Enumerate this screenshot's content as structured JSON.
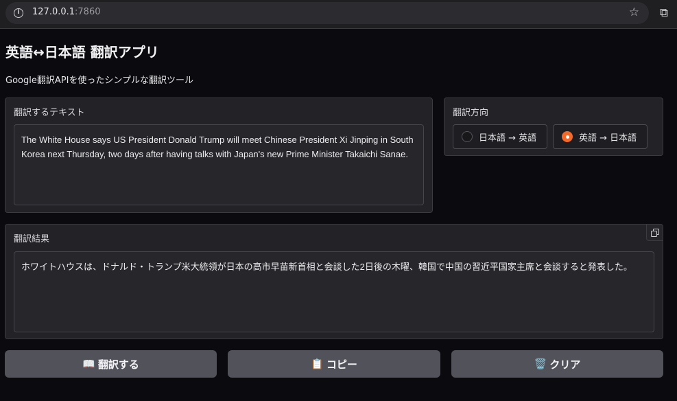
{
  "browser": {
    "url_host": "127.0.0.1",
    "url_port": ":7860",
    "icons": [
      "info-icon",
      "star-icon",
      "extensions-icon"
    ]
  },
  "app": {
    "title": "英語↔日本語 翻訳アプリ",
    "description": "Google翻訳APIを使ったシンプルな翻訳ツール"
  },
  "input": {
    "label": "翻訳するテキスト",
    "value": "The White House says US President Donald Trump will meet Chinese President Xi Jinping in South Korea next Thursday, two days after having talks with Japan's new Prime Minister Takaichi Sanae."
  },
  "direction": {
    "label": "翻訳方向",
    "options": [
      {
        "label": "日本語 → 英語",
        "selected": false
      },
      {
        "label": "英語 → 日本語",
        "selected": true
      }
    ],
    "accent_color": "#f26a2b"
  },
  "output": {
    "label": "翻訳結果",
    "value": "ホワイトハウスは、ドナルド・トランプ米大統領が日本の高市早苗新首相と会談した2日後の木曜、韓国で中国の習近平国家主席と会談すると発表した。"
  },
  "buttons": {
    "translate": {
      "icon": "📖",
      "label": "翻訳する"
    },
    "copy": {
      "icon": "📋",
      "label": "コピー"
    },
    "clear": {
      "icon": "🗑️",
      "label": "クリア"
    }
  }
}
